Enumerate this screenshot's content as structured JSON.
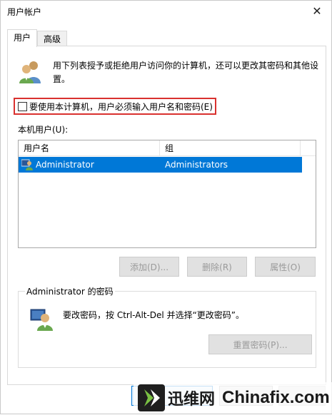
{
  "window": {
    "title": "用户帐户"
  },
  "tabs": [
    {
      "label": "用户",
      "active": true
    },
    {
      "label": "高级",
      "active": false
    }
  ],
  "intro": {
    "text": "用下列表授予或拒绝用户访问你的计算机，还可以更改其密码和其他设置。"
  },
  "require_login": {
    "label": "要使用本计算机，用户必须输入用户名和密码(E)",
    "checked": false
  },
  "local_users": {
    "label": "本机用户(U):",
    "columns": [
      "用户名",
      "组"
    ],
    "rows": [
      {
        "username": "Administrator",
        "group": "Administrators",
        "selected": true
      }
    ]
  },
  "buttons": {
    "add": "添加(D)...",
    "remove": "删除(R)",
    "properties": "属性(O)"
  },
  "password_group": {
    "title": "Administrator 的密码",
    "text": "要改密码，按 Ctrl-Alt-Del 并选择“更改密码”。",
    "reset_button": "重置密码(P)..."
  },
  "watermark": {
    "cn": "迅维网",
    "en": "Chinafix.com"
  },
  "colors": {
    "selection": "#0078d7",
    "highlight_border": "#d9312f",
    "logo_green": "#7ac143"
  }
}
